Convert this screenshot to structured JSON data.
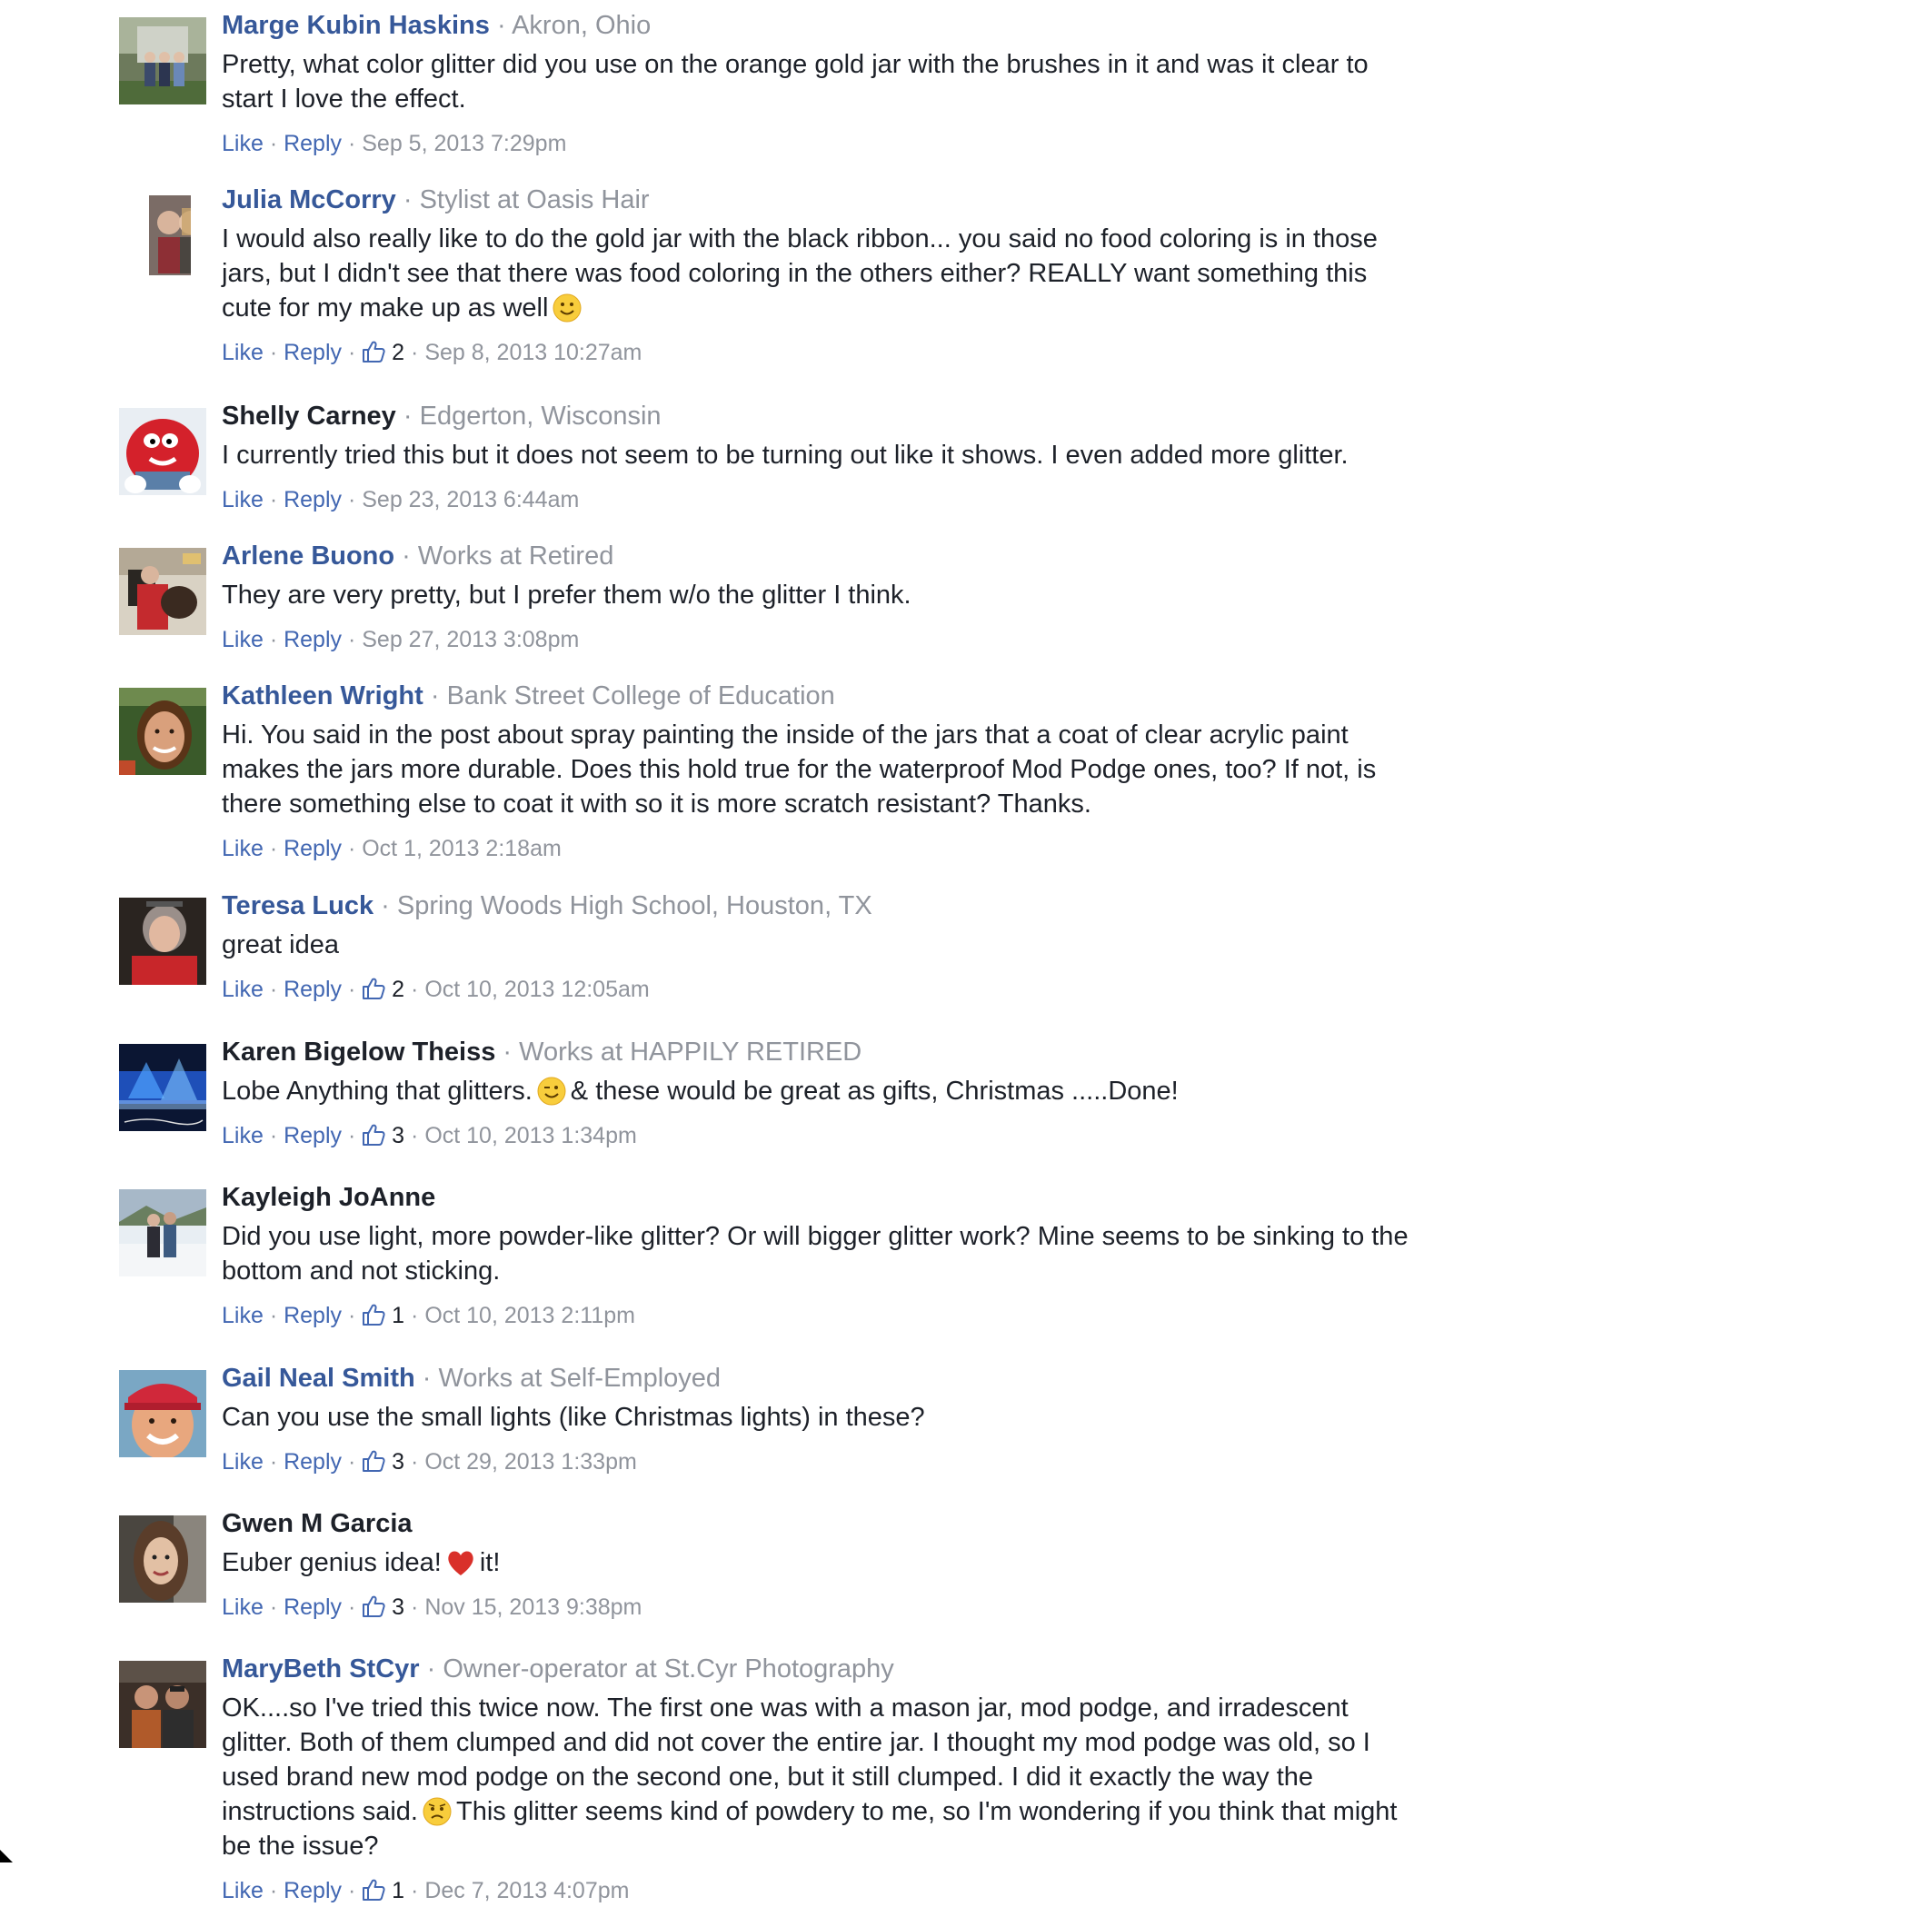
{
  "comments": [
    {
      "author": "Marge Kubin Haskins",
      "affiliation": "Akron, Ohio",
      "author_style": "link",
      "text": [
        "Pretty, what color glitter did you use on the orange gold jar with the brushes in it and was it clear to start I love the effect."
      ],
      "like_label": "Like",
      "reply_label": "Reply",
      "likes": "",
      "timestamp": "Sep 5, 2013 7:29pm",
      "avatar_icon": "profile-photo-group-outdoors"
    },
    {
      "author": "Julia McCorry",
      "affiliation": "Stylist at Oasis Hair",
      "author_style": "link",
      "text": [
        "I would also really like to do the gold jar with the black ribbon... you said no food coloring is in those jars, but I didn't see that there was food coloring in the others either? REALLY want something this cute for my make up as well",
        "smile-emoji",
        ""
      ],
      "like_label": "Like",
      "reply_label": "Reply",
      "likes": "2",
      "timestamp": "Sep 8, 2013 10:27am",
      "avatar_icon": "profile-photo-couple"
    },
    {
      "author": "Shelly Carney",
      "affiliation": "Edgerton, Wisconsin",
      "author_style": "dark",
      "text": [
        "I currently tried this but it does not seem to be turning out like it shows. I even added more glitter."
      ],
      "like_label": "Like",
      "reply_label": "Reply",
      "likes": "",
      "timestamp": "Sep 23, 2013 6:44am",
      "avatar_icon": "profile-photo-red-candy-character"
    },
    {
      "author": "Arlene Buono",
      "affiliation": "Works at Retired",
      "author_style": "link",
      "text": [
        "They are very pretty, but I prefer them w/o the glitter I think."
      ],
      "like_label": "Like",
      "reply_label": "Reply",
      "likes": "",
      "timestamp": "Sep 27, 2013 3:08pm",
      "avatar_icon": "profile-photo-person-with-dog"
    },
    {
      "author": "Kathleen Wright",
      "affiliation": "Bank Street College of Education",
      "author_style": "link",
      "text": [
        "Hi. You said in the post about spray painting the inside of the jars that a coat of clear acrylic paint makes the jars more durable. Does this hold true for the waterproof Mod Podge ones, too? If not, is there something else to coat it with so it is more scratch resistant? Thanks."
      ],
      "like_label": "Like",
      "reply_label": "Reply",
      "likes": "",
      "timestamp": "Oct 1, 2013 2:18am",
      "avatar_icon": "profile-photo-smiling-woman"
    },
    {
      "author": "Teresa Luck",
      "affiliation": "Spring Woods High School, Houston, TX",
      "author_style": "link",
      "text": [
        "great idea"
      ],
      "like_label": "Like",
      "reply_label": "Reply",
      "likes": "2",
      "timestamp": "Oct 10, 2013 12:05am",
      "avatar_icon": "profile-photo-woman-red-shirt"
    },
    {
      "author": "Karen Bigelow Theiss",
      "affiliation": "Works at HAPPILY RETIRED",
      "author_style": "dark",
      "text": [
        "Lobe Anything that glitters.",
        "wink-emoji",
        "& these would be great as gifts, Christmas .....Done!"
      ],
      "like_label": "Like",
      "reply_label": "Reply",
      "likes": "3",
      "timestamp": "Oct 10, 2013 1:34pm",
      "avatar_icon": "profile-photo-blue-stage"
    },
    {
      "author": "Kayleigh JoAnne",
      "affiliation": "",
      "author_style": "dark",
      "text": [
        "Did you use light, more powder-like glitter? Or will bigger glitter work? Mine seems to be sinking to the bottom and not sticking."
      ],
      "like_label": "Like",
      "reply_label": "Reply",
      "likes": "1",
      "timestamp": "Oct 10, 2013 2:11pm",
      "avatar_icon": "profile-photo-couple-snow"
    },
    {
      "author": "Gail Neal Smith",
      "affiliation": "Works at Self-Employed",
      "author_style": "link",
      "text": [
        "Can you use the small lights (like Christmas lights) in these?"
      ],
      "like_label": "Like",
      "reply_label": "Reply",
      "likes": "3",
      "timestamp": "Oct 29, 2013 1:33pm",
      "avatar_icon": "profile-photo-woman-red-cap"
    },
    {
      "author": "Gwen M Garcia",
      "affiliation": "",
      "author_style": "dark",
      "text": [
        "Euber genius idea!",
        "heart-emoji",
        "it!"
      ],
      "like_label": "Like",
      "reply_label": "Reply",
      "likes": "3",
      "timestamp": "Nov 15, 2013 9:38pm",
      "avatar_icon": "profile-photo-woman-portrait"
    },
    {
      "author": "MaryBeth StCyr",
      "affiliation": "Owner-operator at St.Cyr Photography",
      "author_style": "link",
      "text": [
        "OK....so I've tried this twice now. The first one was with a mason jar, mod podge, and irradescent glitter. Both of them clumped and did not cover the entire jar. I thought my mod podge was old, so I used brand new mod podge on the second one, but it still clumped. I did it exactly the way the instructions said.",
        "worried-emoji",
        "This glitter seems kind of powdery to me, so I'm wondering if you think that might be the issue?"
      ],
      "like_label": "Like",
      "reply_label": "Reply",
      "likes": "1",
      "timestamp": "Dec 7, 2013 4:07pm",
      "avatar_icon": "profile-photo-two-men"
    }
  ],
  "colors": {
    "link": "#4267b2",
    "author_link": "#365899",
    "author_dark": "#1d2129",
    "muted": "#90949c",
    "text": "#1d2129"
  }
}
